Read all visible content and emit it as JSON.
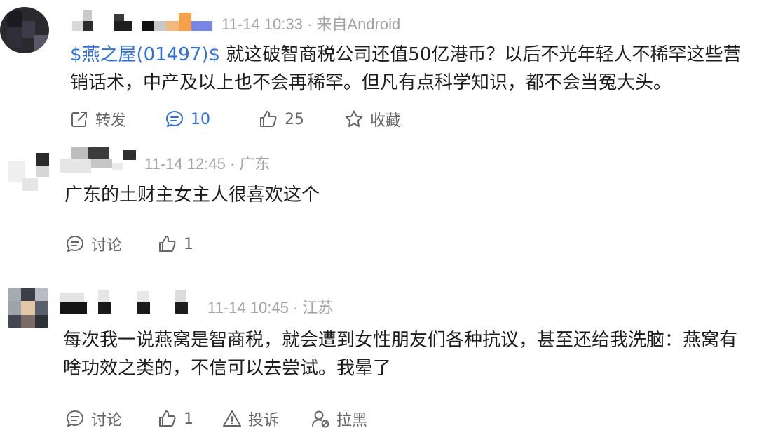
{
  "posts": [
    {
      "time": "11-14 10:33",
      "source": "来自Android",
      "stock_tag": "$燕之屋(01497)$",
      "text": " 就这破智商税公司还值50亿港币？以后不光年轻人不稀罕这些营销话术，中产及以上也不会再稀罕。但凡有点科学知识，都不会当冤大头。",
      "actions": {
        "repost_label": "转发",
        "comment_count": "10",
        "like_count": "25",
        "favorite_label": "收藏"
      }
    },
    {
      "time": "11-14 12:45",
      "location": "广东",
      "text": "广东的土财主女主人很喜欢这个",
      "actions": {
        "discuss_label": "讨论",
        "like_count": "1"
      }
    },
    {
      "time": "11-14 10:45",
      "location": "江苏",
      "text": "每次我一说燕窝是智商税，就会遭到女性朋友们各种抗议，甚至还给我洗脑：燕窝有啥功效之类的，不信可以去尝试。我晕了",
      "actions": {
        "discuss_label": "讨论",
        "like_count": "1",
        "report_label": "投诉",
        "block_label": "拉黑"
      }
    }
  ],
  "colors": {
    "link": "#2f6fd6",
    "meta": "#a3a3a3",
    "action": "#666666"
  },
  "icons": [
    "repost-icon",
    "comment-icon",
    "like-icon",
    "star-icon",
    "discuss-icon",
    "warning-icon",
    "block-user-icon"
  ]
}
